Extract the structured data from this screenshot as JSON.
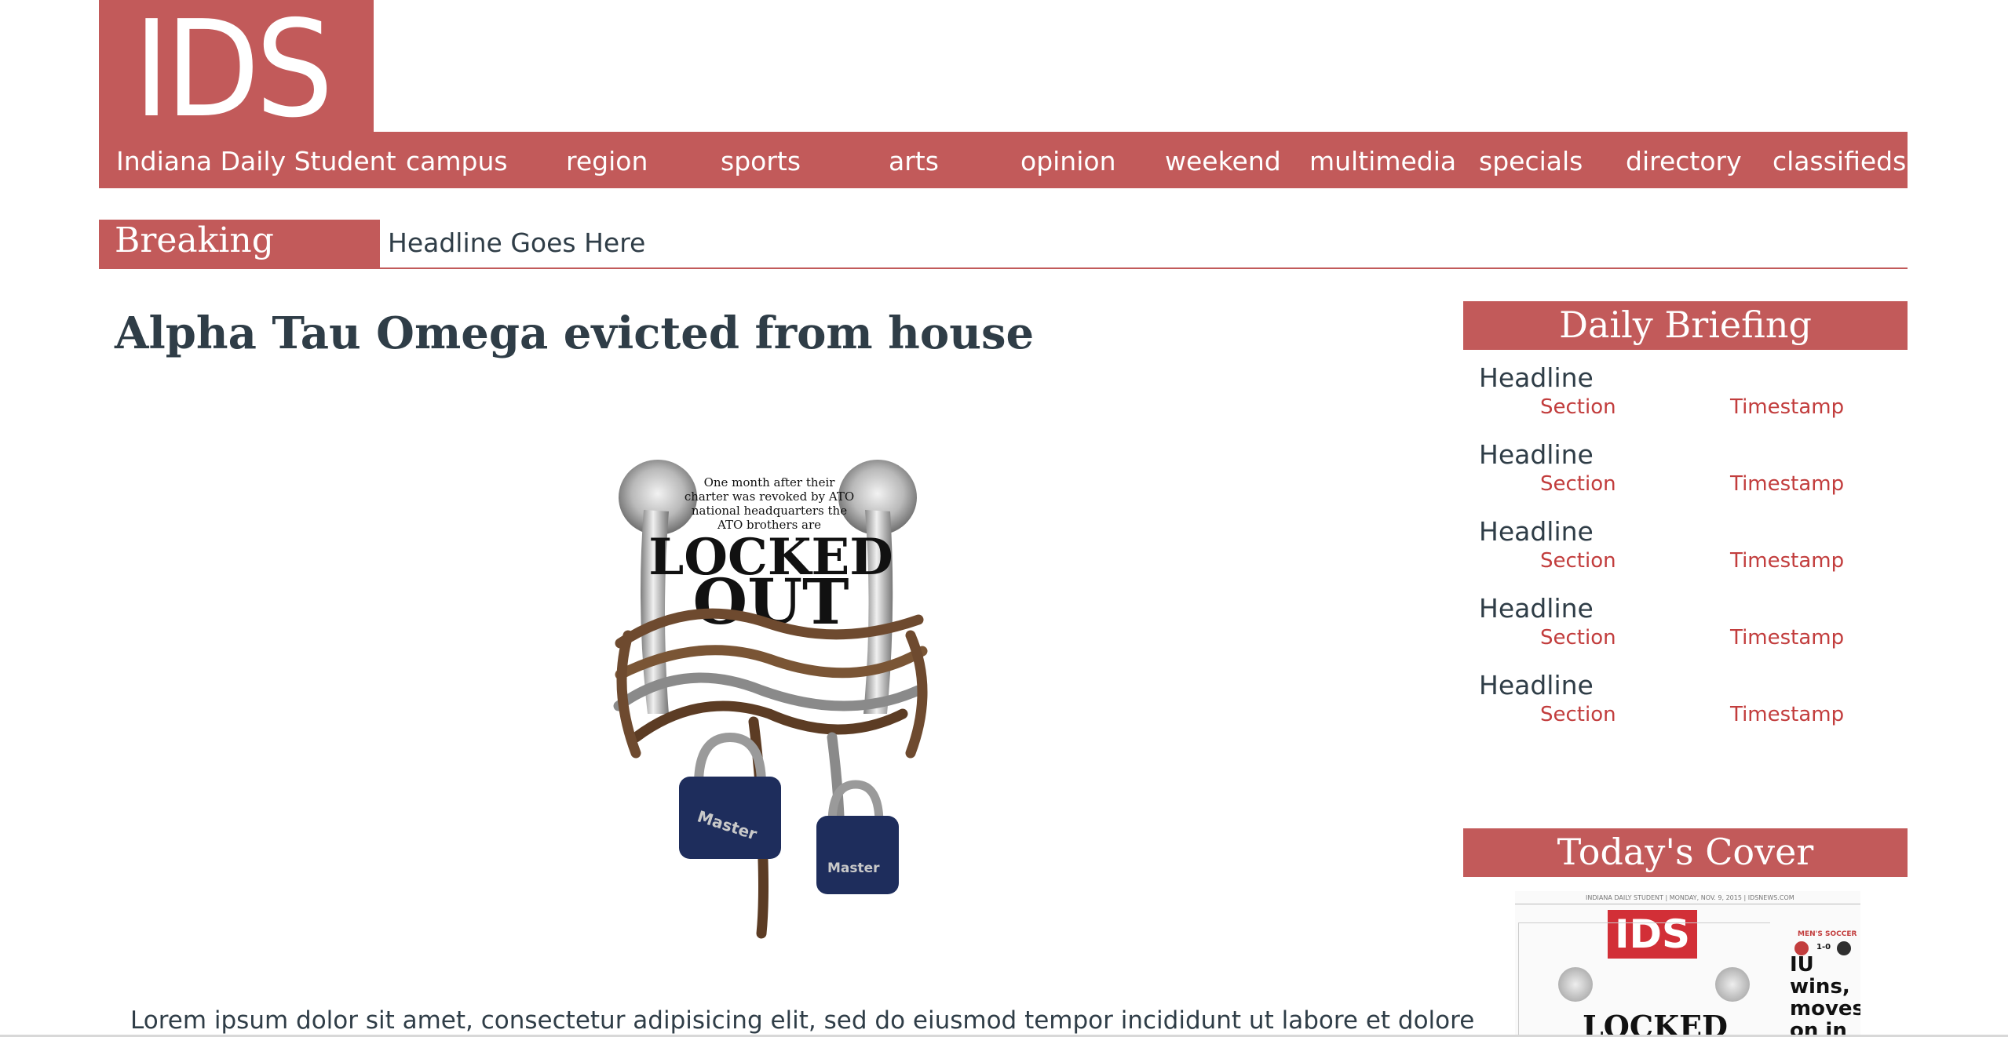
{
  "logo": {
    "text": "IDS"
  },
  "nav": {
    "items": [
      {
        "label": "Indiana Daily Student"
      },
      {
        "label": "campus"
      },
      {
        "label": "region"
      },
      {
        "label": "sports"
      },
      {
        "label": "arts"
      },
      {
        "label": "opinion"
      },
      {
        "label": "weekend"
      },
      {
        "label": "multimedia"
      },
      {
        "label": "specials"
      },
      {
        "label": "directory"
      },
      {
        "label": "classifieds"
      }
    ]
  },
  "breaking": {
    "label": "Breaking News",
    "headline": "Headline Goes Here"
  },
  "article": {
    "title": "Alpha Tau Omega evicted from house",
    "image": {
      "caption_lines": [
        "One month after their",
        "charter was revoked by ATO",
        "national headquarters the",
        "ATO brothers are"
      ],
      "big_line1": "LOCKED",
      "big_line2": "OUT",
      "lock_brand": "Master"
    },
    "body_first_line": "Lorem ipsum dolor sit amet, consectetur adipisicing elit, sed do eiusmod tempor incididunt ut labore et dolore"
  },
  "sidebar": {
    "daily_briefing": {
      "title": "Daily Briefing",
      "items": [
        {
          "headline": "Headline",
          "section": "Section",
          "timestamp": "Timestamp"
        },
        {
          "headline": "Headline",
          "section": "Section",
          "timestamp": "Timestamp"
        },
        {
          "headline": "Headline",
          "section": "Section",
          "timestamp": "Timestamp"
        },
        {
          "headline": "Headline",
          "section": "Section",
          "timestamp": "Timestamp"
        },
        {
          "headline": "Headline",
          "section": "Section",
          "timestamp": "Timestamp"
        }
      ]
    },
    "todays_cover": {
      "title": "Today's Cover",
      "masthead_line": "INDIANA DAILY STUDENT | MONDAY, NOV. 9, 2015 | IDSNEWS.COM",
      "logo": "IDS",
      "kicker": "MEN'S SOCCER",
      "score": "1-0",
      "headline_lines": [
        "IU wins,",
        "moves",
        "on in"
      ],
      "teaser": "LOCKED"
    }
  },
  "colors": {
    "brand_red": "#c25a5a",
    "link_red": "#c23d3d",
    "text_dark": "#2f3d47"
  }
}
